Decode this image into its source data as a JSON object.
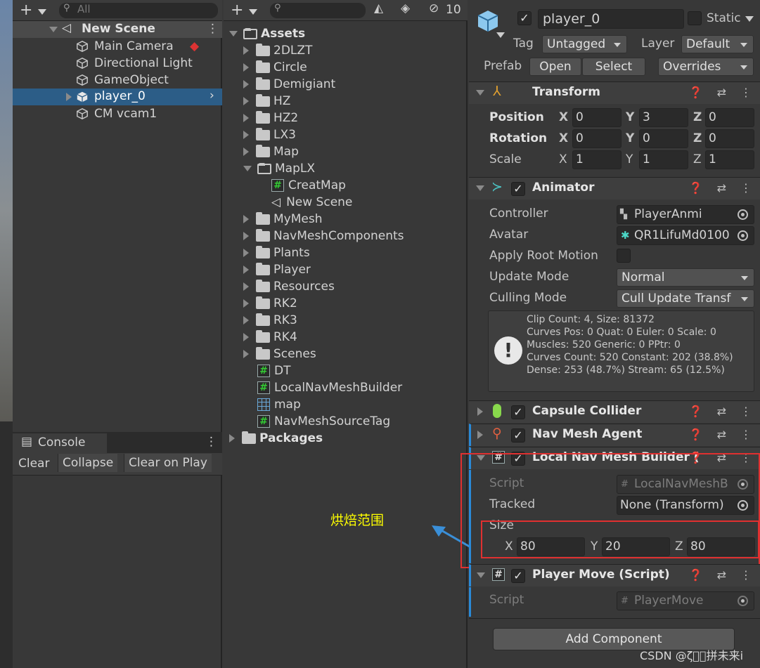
{
  "hierarchy": {
    "search_placeholder": "All",
    "scene_name": "New Scene",
    "items": [
      "Main Camera",
      "Directional Light",
      "GameObject",
      "player_0",
      "CM vcam1"
    ]
  },
  "console": {
    "tab": "Console",
    "buttons": [
      "Clear",
      "Collapse",
      "Clear on Play"
    ]
  },
  "project": {
    "hidden_count": "10",
    "root": "Assets",
    "folders": [
      "2DLZT",
      "Circle",
      "Demigiant",
      "HZ",
      "HZ2",
      "LX3",
      "Map",
      "MapLX"
    ],
    "maplx_children": [
      "CreatMap",
      "New Scene"
    ],
    "folders2": [
      "MyMesh",
      "NavMeshComponents",
      "Plants",
      "Player",
      "Resources",
      "RK2",
      "RK3",
      "RK4",
      "Scenes"
    ],
    "files": [
      "DT",
      "LocalNavMeshBuilder",
      "map",
      "NavMeshSourceTag"
    ],
    "packages": "Packages"
  },
  "inspector": {
    "object_name": "player_0",
    "static_label": "Static",
    "tag_label": "Tag",
    "tag_value": "Untagged",
    "layer_label": "Layer",
    "layer_value": "Default",
    "prefab_label": "Prefab",
    "open_btn": "Open",
    "select_btn": "Select",
    "overrides_btn": "Overrides",
    "transform": {
      "title": "Transform",
      "position_label": "Position",
      "rotation_label": "Rotation",
      "scale_label": "Scale",
      "axis_x": "X",
      "axis_y": "Y",
      "axis_z": "Z",
      "position": [
        "0",
        "3",
        "0"
      ],
      "rotation": [
        "0",
        "0",
        "0"
      ],
      "scale": [
        "1",
        "1",
        "1"
      ]
    },
    "animator": {
      "title": "Animator",
      "controller_label": "Controller",
      "controller_value": "PlayerAnmi",
      "avatar_label": "Avatar",
      "avatar_value": "QR1LifuMd0100",
      "apply_root_label": "Apply Root Motion",
      "update_mode_label": "Update Mode",
      "update_mode_value": "Normal",
      "culling_mode_label": "Culling Mode",
      "culling_mode_value": "Cull Update Transf",
      "info": [
        "Clip Count: 4, Size: 81372",
        "Curves Pos: 0 Quat: 0 Euler: 0 Scale: 0",
        "Muscles: 520 Generic: 0 PPtr: 0",
        "Curves Count: 520 Constant: 202 (38.8%)",
        "Dense: 253 (48.7%) Stream: 65 (12.5%)"
      ]
    },
    "capsule_title": "Capsule Collider",
    "navagent_title": "Nav Mesh Agent",
    "local_nav": {
      "title": "Local Nav Mesh Builder (",
      "script_label": "Script",
      "script_value": "LocalNavMeshB",
      "tracked_label": "Tracked",
      "tracked_value": "None (Transform)",
      "size_label": "Size",
      "size": [
        "80",
        "20",
        "80"
      ]
    },
    "player_move": {
      "title": "Player Move (Script)",
      "script_label": "Script",
      "script_value": "PlayerMove"
    },
    "add_component": "Add Component"
  },
  "annotation": "烘焙范围",
  "watermark": "CSDN @ζ\u0000\u0000拼未来i",
  "colors": {
    "background": "#383838",
    "selection": "#2c5d87",
    "highlight_box": "#e03030",
    "annotation_text": "#ffff00",
    "arrow": "#3a8fd8"
  }
}
